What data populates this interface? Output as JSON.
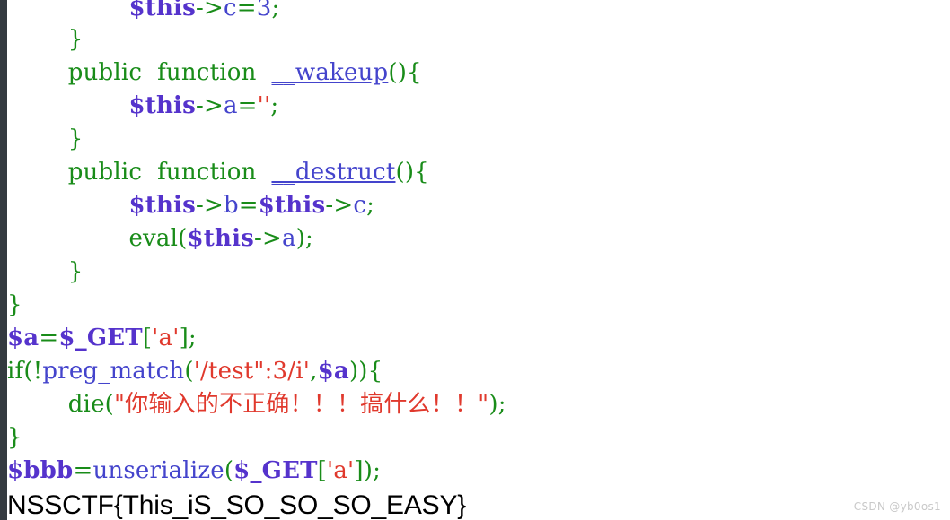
{
  "editor": {
    "language": "PHP",
    "background_color": "#ffffff",
    "gutter_color": "#343a40",
    "colors": {
      "variable": "#5533cc",
      "keyword": "#198c19",
      "function": "#4444cc",
      "punctuation": "#198c19",
      "string": "#e0392d",
      "number": "#4444cc",
      "flag_text": "#000000",
      "watermark": "#c9c9c9"
    }
  },
  "code": {
    "lines": [
      {
        "id": "line-1",
        "indent": 2,
        "text": "$this->c=3;",
        "tokens": [
          {
            "t": "$this",
            "c": "t-var"
          },
          {
            "t": "->",
            "c": "t-punct"
          },
          {
            "t": "c",
            "c": "t-prop"
          },
          {
            "t": "=",
            "c": "t-punct"
          },
          {
            "t": "3",
            "c": "t-num"
          },
          {
            "t": ";",
            "c": "t-punct"
          }
        ]
      },
      {
        "id": "line-2",
        "indent": 1,
        "text": "}",
        "tokens": [
          {
            "t": "}",
            "c": "t-brace"
          }
        ]
      },
      {
        "id": "line-3",
        "indent": 1,
        "text": "public function __wakeup(){",
        "tokens": [
          {
            "t": "public",
            "c": "t-kw"
          },
          {
            "t": "  ",
            "c": "t-plain"
          },
          {
            "t": "function",
            "c": "t-kw"
          },
          {
            "t": "  ",
            "c": "t-plain"
          },
          {
            "t": "__wakeup",
            "c": "t-magic"
          },
          {
            "t": "()",
            "c": "t-punct"
          },
          {
            "t": "{",
            "c": "t-brace"
          }
        ]
      },
      {
        "id": "line-4",
        "indent": 2,
        "text": "$this->a='';",
        "tokens": [
          {
            "t": "$this",
            "c": "t-var"
          },
          {
            "t": "->",
            "c": "t-punct"
          },
          {
            "t": "a",
            "c": "t-prop"
          },
          {
            "t": "=",
            "c": "t-punct"
          },
          {
            "t": "''",
            "c": "t-str"
          },
          {
            "t": ";",
            "c": "t-punct"
          }
        ]
      },
      {
        "id": "line-5",
        "indent": 1,
        "text": "}",
        "tokens": [
          {
            "t": "}",
            "c": "t-brace"
          }
        ]
      },
      {
        "id": "line-6",
        "indent": 1,
        "text": "public function __destruct(){",
        "tokens": [
          {
            "t": "public",
            "c": "t-kw"
          },
          {
            "t": "  ",
            "c": "t-plain"
          },
          {
            "t": "function",
            "c": "t-kw"
          },
          {
            "t": "  ",
            "c": "t-plain"
          },
          {
            "t": "__destruct",
            "c": "t-magic"
          },
          {
            "t": "()",
            "c": "t-punct"
          },
          {
            "t": "{",
            "c": "t-brace"
          }
        ]
      },
      {
        "id": "line-7",
        "indent": 2,
        "text": "$this->b=$this->c;",
        "tokens": [
          {
            "t": "$this",
            "c": "t-var"
          },
          {
            "t": "->",
            "c": "t-punct"
          },
          {
            "t": "b",
            "c": "t-prop"
          },
          {
            "t": "=",
            "c": "t-punct"
          },
          {
            "t": "$this",
            "c": "t-var"
          },
          {
            "t": "->",
            "c": "t-punct"
          },
          {
            "t": "c",
            "c": "t-prop"
          },
          {
            "t": ";",
            "c": "t-punct"
          }
        ]
      },
      {
        "id": "line-8",
        "indent": 2,
        "text": "eval($this->a);",
        "tokens": [
          {
            "t": "eval",
            "c": "t-fn-green"
          },
          {
            "t": "(",
            "c": "t-punct"
          },
          {
            "t": "$this",
            "c": "t-var"
          },
          {
            "t": "->",
            "c": "t-punct"
          },
          {
            "t": "a",
            "c": "t-prop"
          },
          {
            "t": ")",
            "c": "t-punct"
          },
          {
            "t": ";",
            "c": "t-punct"
          }
        ]
      },
      {
        "id": "line-9",
        "indent": 1,
        "text": "}",
        "tokens": [
          {
            "t": "}",
            "c": "t-brace"
          }
        ]
      },
      {
        "id": "line-10",
        "indent": 0,
        "text": "}",
        "tokens": [
          {
            "t": "}",
            "c": "t-brace"
          }
        ]
      },
      {
        "id": "line-11",
        "indent": 0,
        "text": "$a=$_GET['a'];",
        "tokens": [
          {
            "t": "$a",
            "c": "t-var"
          },
          {
            "t": "=",
            "c": "t-punct"
          },
          {
            "t": "$_GET",
            "c": "t-var"
          },
          {
            "t": "[",
            "c": "t-punct"
          },
          {
            "t": "'a'",
            "c": "t-str"
          },
          {
            "t": "]",
            "c": "t-punct"
          },
          {
            "t": ";",
            "c": "t-punct"
          }
        ]
      },
      {
        "id": "line-12",
        "indent": 0,
        "text": "if(!preg_match('/test\":3/i',$a)){",
        "tokens": [
          {
            "t": "if",
            "c": "t-kw"
          },
          {
            "t": "(",
            "c": "t-punct"
          },
          {
            "t": "!",
            "c": "t-punct"
          },
          {
            "t": "preg_match",
            "c": "t-fn"
          },
          {
            "t": "(",
            "c": "t-punct"
          },
          {
            "t": "'/test\":3/i'",
            "c": "t-str"
          },
          {
            "t": ",",
            "c": "t-punct"
          },
          {
            "t": "$a",
            "c": "t-var"
          },
          {
            "t": "))",
            "c": "t-punct"
          },
          {
            "t": "{",
            "c": "t-brace"
          }
        ]
      },
      {
        "id": "line-13",
        "indent": 1,
        "text": "die(\"你输入的不正确！！！搞什么！！\");",
        "tokens": [
          {
            "t": "die",
            "c": "t-fn-green"
          },
          {
            "t": "(",
            "c": "t-punct"
          },
          {
            "t": "\"你输入的不正确！！！搞什么！！\"",
            "c": "t-str"
          },
          {
            "t": ")",
            "c": "t-punct"
          },
          {
            "t": ";",
            "c": "t-punct"
          }
        ]
      },
      {
        "id": "line-14",
        "indent": 0,
        "text": "}",
        "tokens": [
          {
            "t": "}",
            "c": "t-brace"
          }
        ]
      },
      {
        "id": "line-15",
        "indent": 0,
        "text": "$bbb=unserialize($_GET['a']);",
        "tokens": [
          {
            "t": "$bbb",
            "c": "t-var"
          },
          {
            "t": "=",
            "c": "t-punct"
          },
          {
            "t": "unserialize",
            "c": "t-fn"
          },
          {
            "t": "(",
            "c": "t-punct"
          },
          {
            "t": "$_GET",
            "c": "t-var"
          },
          {
            "t": "[",
            "c": "t-punct"
          },
          {
            "t": "'a'",
            "c": "t-str"
          },
          {
            "t": "]",
            "c": "t-punct"
          },
          {
            "t": ")",
            "c": "t-punct"
          },
          {
            "t": ";",
            "c": "t-punct"
          }
        ]
      }
    ]
  },
  "flag": {
    "text": "NSSCTF{This_iS_SO_SO_SO_EASY}"
  },
  "watermark": {
    "text": "CSDN @yb0os1"
  }
}
